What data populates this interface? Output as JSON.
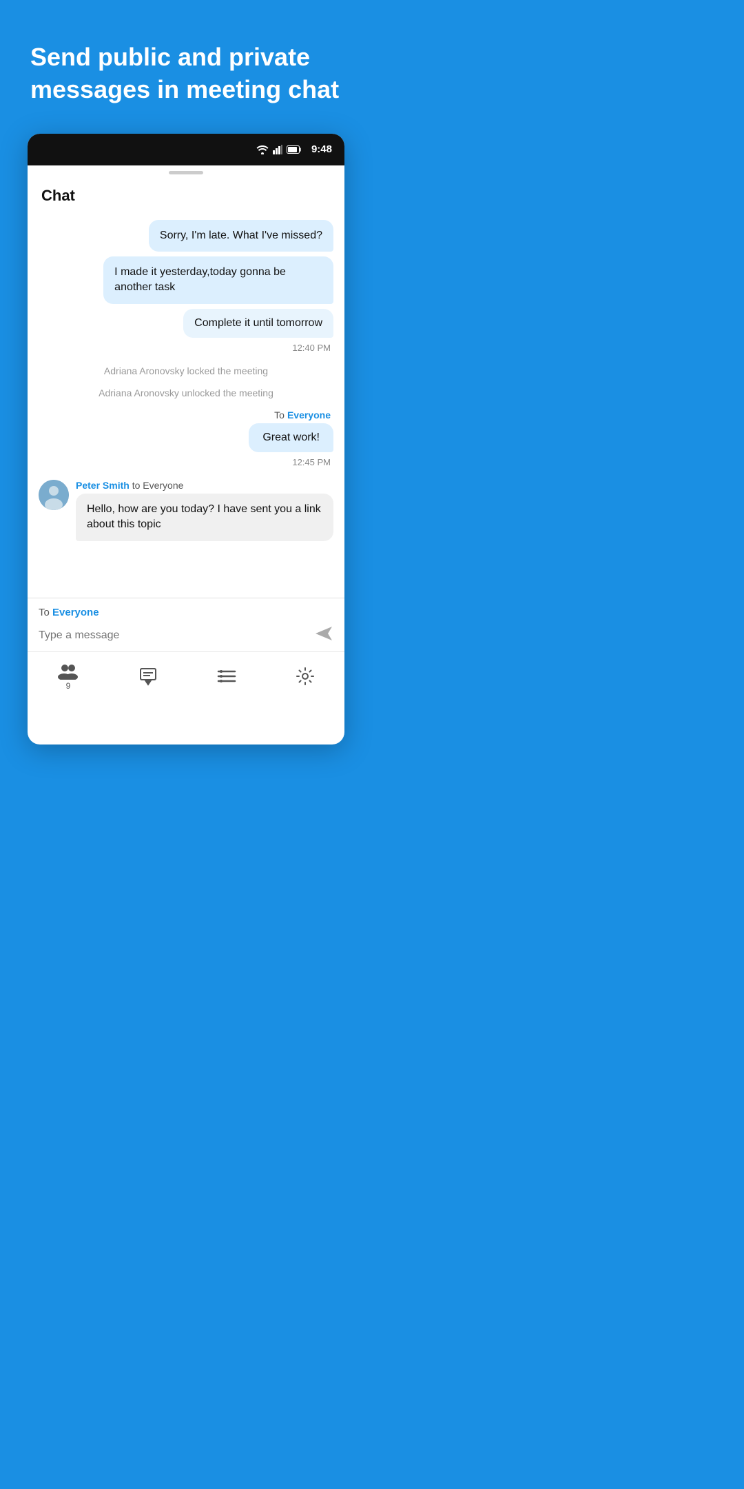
{
  "hero": {
    "title": "Send public and private messages in meeting chat"
  },
  "statusBar": {
    "time": "9:48"
  },
  "chat": {
    "title": "Chat"
  },
  "messages": [
    {
      "type": "bubble-right",
      "text": "Sorry, I'm late. What I've missed?"
    },
    {
      "type": "bubble-right",
      "text": "I made it yesterday,today gonna be another task"
    },
    {
      "type": "bubble-own",
      "text": "Complete it until tomorrow"
    },
    {
      "type": "timestamp",
      "text": "12:40 PM"
    },
    {
      "type": "system",
      "text": "Adriana Aronovsky locked the meeting"
    },
    {
      "type": "system",
      "text": "Adriana Aronovsky unlocked the meeting"
    },
    {
      "type": "to-everyone",
      "label": "To",
      "everyone": "Everyone"
    },
    {
      "type": "bubble-great-work",
      "text": "Great work!"
    },
    {
      "type": "timestamp",
      "text": "12:45 PM"
    },
    {
      "type": "incoming",
      "sender": "Peter Smith",
      "recipient": "to Everyone",
      "text": "Hello, how are you today? I have sent you a link about this topic"
    }
  ],
  "inputArea": {
    "toLabel": "To",
    "everyone": "Everyone",
    "placeholder": "Type a message"
  },
  "bottomNav": [
    {
      "id": "participants",
      "icon": "participants",
      "badge": "9"
    },
    {
      "id": "chat",
      "icon": "chat",
      "badge": ""
    },
    {
      "id": "more",
      "icon": "more",
      "badge": ""
    },
    {
      "id": "settings",
      "icon": "settings",
      "badge": ""
    }
  ]
}
